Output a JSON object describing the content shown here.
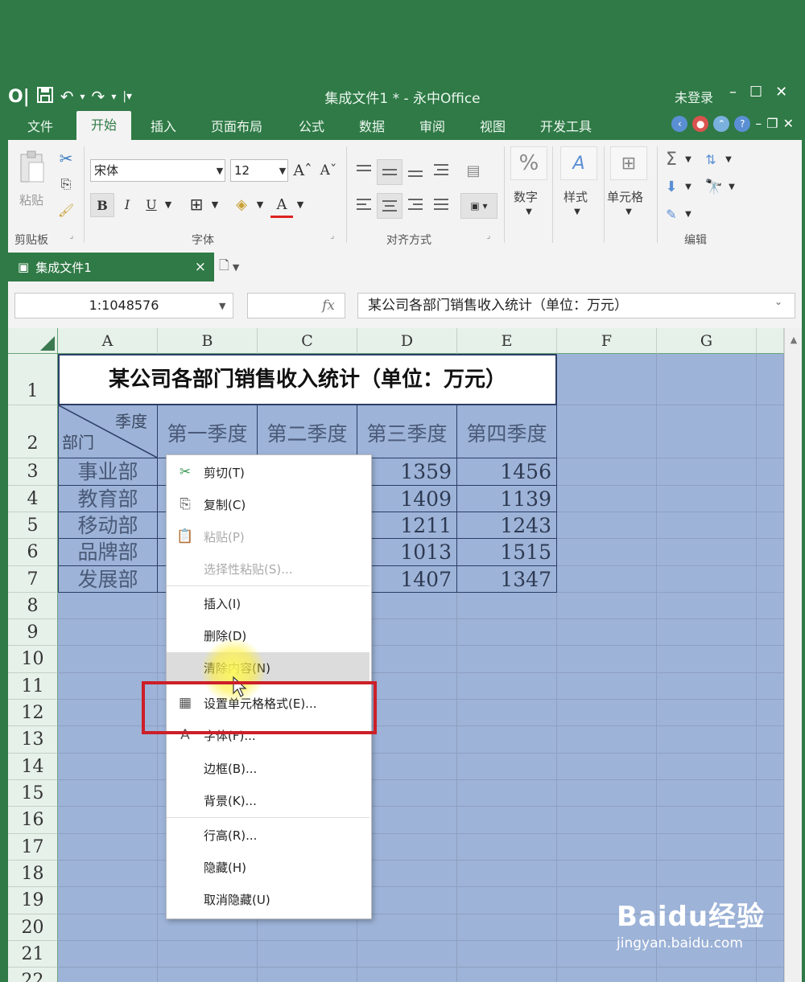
{
  "window": {
    "title": "集成文件1 * - 永中Office",
    "login": "未登录"
  },
  "tabs": [
    "文件",
    "开始",
    "插入",
    "页面布局",
    "公式",
    "数据",
    "审阅",
    "视图",
    "开发工具"
  ],
  "ribbon": {
    "clipboard": {
      "paste": "粘贴",
      "group": "剪贴板"
    },
    "font": {
      "name": "宋体",
      "size": "12",
      "bold": "B",
      "italic": "I",
      "underline": "U",
      "group": "字体"
    },
    "alignment": {
      "group": "对齐方式"
    },
    "number": {
      "icon_text": "%",
      "label": "数字"
    },
    "style": {
      "label": "样式"
    },
    "cells": {
      "label": "单元格"
    },
    "editing": {
      "group": "编辑"
    }
  },
  "doc_tab": {
    "name": "集成文件1",
    "close": "×"
  },
  "formula_bar": {
    "name_box": "1:1048576",
    "fx": "fx",
    "content": "某公司各部门销售收入统计（单位：万元）"
  },
  "columns": [
    "A",
    "B",
    "C",
    "D",
    "E",
    "F",
    "G"
  ],
  "rows": [
    "1",
    "2",
    "3",
    "4",
    "5",
    "6",
    "7",
    "8",
    "9",
    "10",
    "11",
    "12",
    "13",
    "14",
    "15",
    "16",
    "17",
    "18",
    "19",
    "20",
    "21",
    "22"
  ],
  "sheet": {
    "title": "某公司各部门销售收入统计（单位：万元）",
    "header_corner_top": "季度",
    "header_corner_bottom": "部门",
    "quarters": [
      "第一季度",
      "第二季度",
      "第三季度",
      "第四季度"
    ],
    "departments": [
      "事业部",
      "教育部",
      "移动部",
      "品牌部",
      "发展部"
    ],
    "q3_values": [
      "1359",
      "1409",
      "1211",
      "1013",
      "1407"
    ],
    "q4_values": [
      "1456",
      "1139",
      "1243",
      "1515",
      "1347"
    ]
  },
  "context_menu": {
    "items": [
      {
        "label": "剪切(T)",
        "icon": "scissors-icon",
        "disabled": false
      },
      {
        "label": "复制(C)",
        "icon": "copy-icon",
        "disabled": false
      },
      {
        "label": "粘贴(P)",
        "icon": "paste-icon",
        "disabled": true
      },
      {
        "label": "选择性粘贴(S)...",
        "icon": "",
        "disabled": true
      },
      {
        "label": "插入(I)",
        "icon": "",
        "disabled": false
      },
      {
        "label": "删除(D)",
        "icon": "",
        "disabled": false
      },
      {
        "label": "清除内容(N)",
        "icon": "",
        "disabled": false,
        "hover": true
      },
      {
        "label": "设置单元格格式(E)...",
        "icon": "format-cells-icon",
        "disabled": false
      },
      {
        "label": "字体(F)...",
        "icon": "font-icon",
        "disabled": false
      },
      {
        "label": "边框(B)...",
        "icon": "",
        "disabled": false
      },
      {
        "label": "背景(K)...",
        "icon": "",
        "disabled": false
      },
      {
        "label": "行高(R)...",
        "icon": "",
        "disabled": false
      },
      {
        "label": "隐藏(H)",
        "icon": "",
        "disabled": false
      },
      {
        "label": "取消隐藏(U)",
        "icon": "",
        "disabled": false
      }
    ]
  },
  "colors": {
    "brand_green": "#2f7a46",
    "selection_blue": "#9db3d8",
    "highlight_red": "#cc1f28"
  },
  "watermark": {
    "brand": "Baidu经验",
    "url": "jingyan.baidu.com"
  }
}
